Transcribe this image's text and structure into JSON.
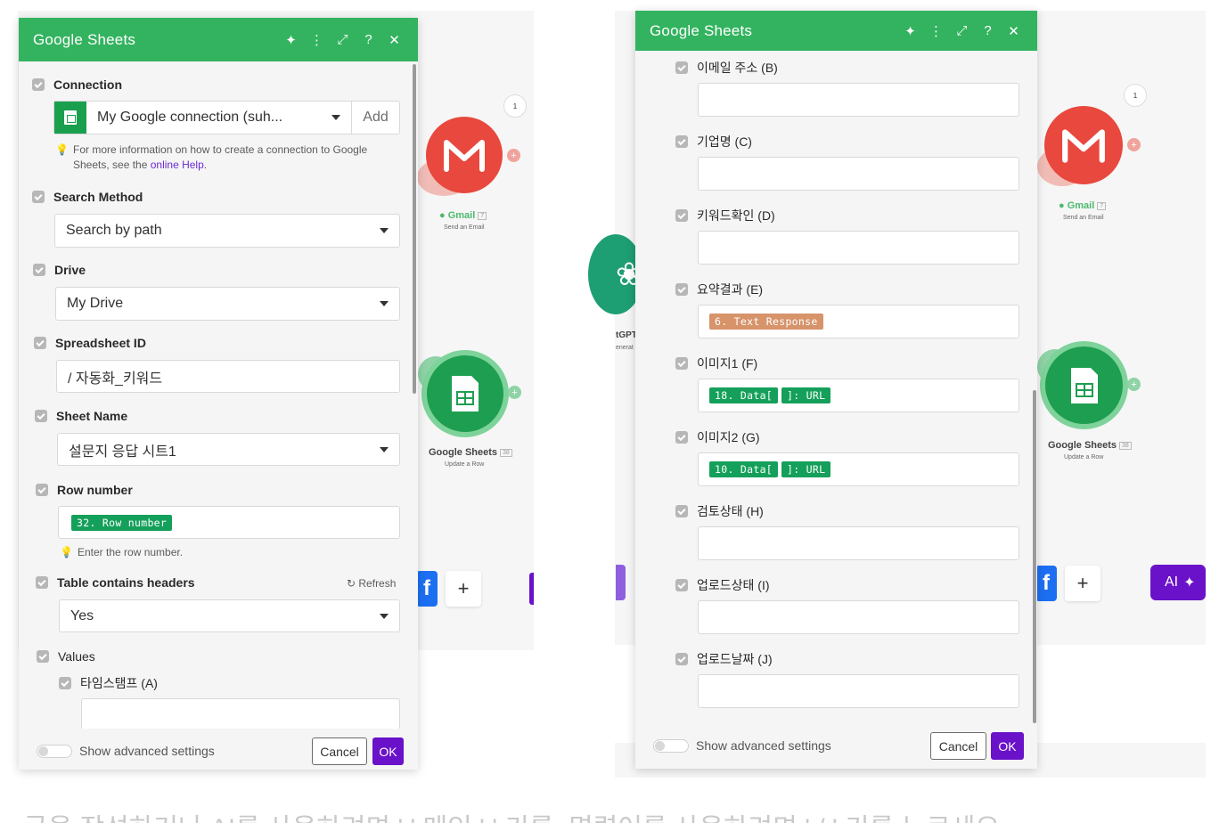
{
  "left_panel": {
    "title": "Google Sheets",
    "connection": {
      "label": "Connection",
      "value": "My Google connection (suh...",
      "add_label": "Add",
      "hint_pre": "For more information on how to create a connection to Google Sheets, see the ",
      "hint_link": "online Help",
      "hint_post": "."
    },
    "search_method": {
      "label": "Search Method",
      "value": "Search by path"
    },
    "drive": {
      "label": "Drive",
      "value": "My Drive"
    },
    "spreadsheet_id": {
      "label": "Spreadsheet ID",
      "value": "/ 자동화_키워드"
    },
    "sheet_name": {
      "label": "Sheet Name",
      "value": "설문지 응답 시트1"
    },
    "row_number": {
      "label": "Row number",
      "pill": "32. Row number",
      "hint": "Enter the row number."
    },
    "table_headers": {
      "label": "Table contains headers",
      "refresh": "Refresh",
      "value": "Yes"
    },
    "values": {
      "label": "Values",
      "field_a": "타임스탬프 (A)"
    },
    "footer": {
      "advanced": "Show advanced settings",
      "cancel": "Cancel",
      "ok": "OK"
    }
  },
  "right_panel": {
    "title": "Google Sheets",
    "fields": [
      {
        "label": "이메일 주소 (B)"
      },
      {
        "label": "기업명 (C)"
      },
      {
        "label": "키워드확인 (D)"
      },
      {
        "label": "요약결과 (E)",
        "pill": "6. Text Response"
      },
      {
        "label": "이미지1 (F)",
        "pill1": "18. Data[",
        "pill2": "]: URL"
      },
      {
        "label": "이미지2 (G)",
        "pill1": "10. Data[",
        "pill2": "]: URL"
      },
      {
        "label": "검토상태 (H)"
      },
      {
        "label": "업로드상태 (I)"
      },
      {
        "label": "업로드날짜 (J)"
      }
    ],
    "footer": {
      "advanced": "Show advanced settings",
      "cancel": "Cancel",
      "ok": "OK"
    }
  },
  "modules": {
    "gmail_name": "Gmail",
    "gmail_id": "7",
    "gmail_sub": "Send an Email",
    "gmail_bubble": "1",
    "sheets_name": "Google Sheets",
    "sheets_id": "38",
    "sheets_sub": "Update a Row",
    "gpt_partial": "tGPT",
    "gpt_sub_partial": "enerat",
    "ai_label": "AI"
  },
  "bottom_caption": "글을 작성하거나 AI를 사용하려면 ' ' 메인 ' ' 키를, 명령어를 사용하려면 ' / ' 키를 누르세요."
}
